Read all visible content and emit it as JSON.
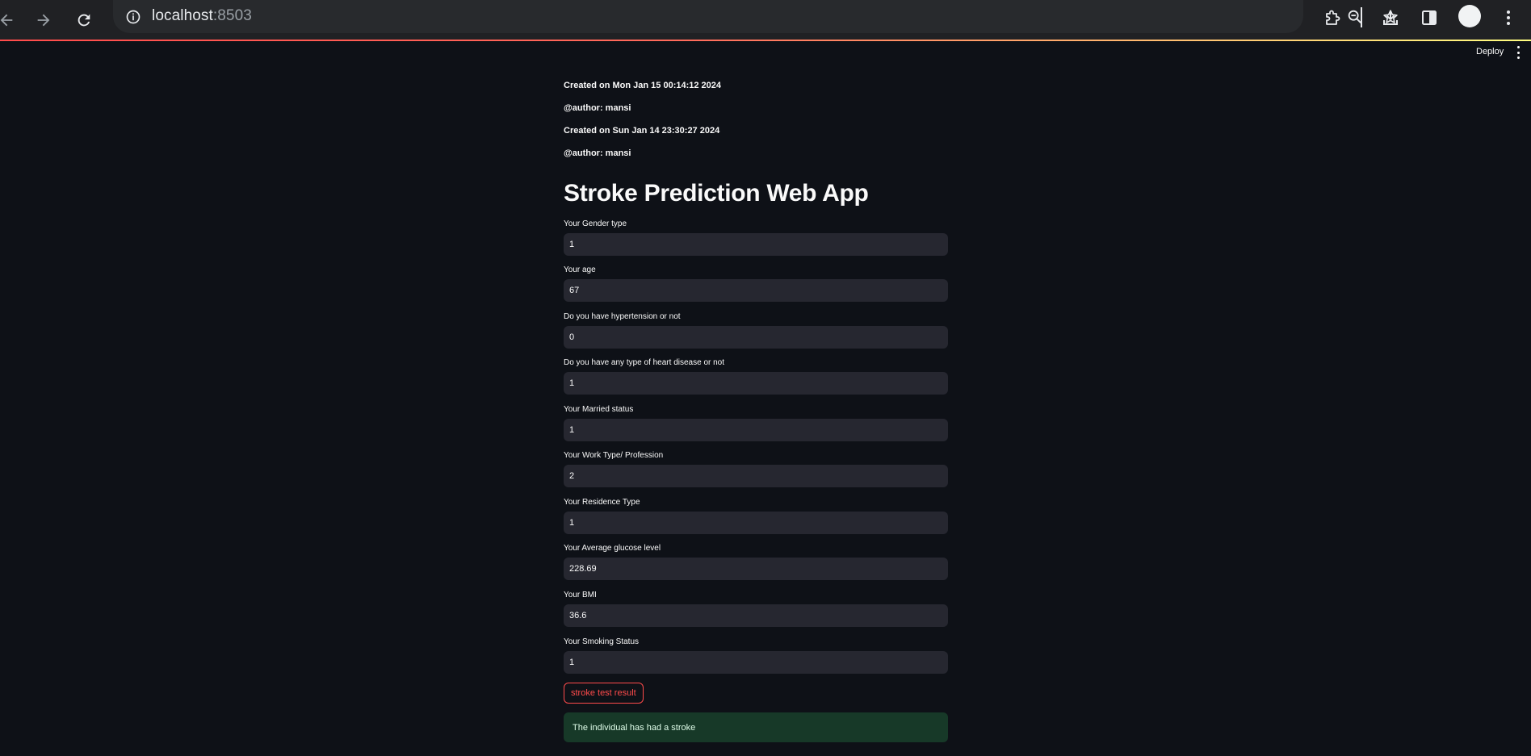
{
  "browser": {
    "url_host": "localhost",
    "url_port": ":8503",
    "icons": [
      "back-icon",
      "forward-icon",
      "reload-icon",
      "site-info-icon",
      "zoom-icon",
      "bookmark-star-icon",
      "extensions-icon",
      "download-icon",
      "side-panel-icon",
      "avatar",
      "menu-icon"
    ]
  },
  "streamlit_header": {
    "deploy_label": "Deploy"
  },
  "meta": [
    "Created on Mon Jan 15 00:14:12 2024",
    "@author: mansi",
    "Created on Sun Jan 14 23:30:27 2024",
    "@author: mansi"
  ],
  "title": "Stroke Prediction Web App",
  "fields": [
    {
      "label": "Your Gender type",
      "value": "1"
    },
    {
      "label": "Your age",
      "value": "67"
    },
    {
      "label": "Do you have hypertension or not",
      "value": "0"
    },
    {
      "label": "Do you have any type of heart disease or not",
      "value": "1"
    },
    {
      "label": "Your Married status",
      "value": "1"
    },
    {
      "label": "Your Work Type/ Profession",
      "value": "2"
    },
    {
      "label": "Your Residence Type",
      "value": "1"
    },
    {
      "label": "Your Average glucose level",
      "value": "228.69"
    },
    {
      "label": "Your BMI",
      "value": "36.6"
    },
    {
      "label": "Your Smoking Status",
      "value": "1"
    }
  ],
  "button_label": "stroke test result",
  "result_message": "The individual has had a stroke",
  "colors": {
    "background": "#0e1117",
    "input_background": "#262730",
    "primary": "#ff4b4b",
    "success_background": "#173928",
    "success_text": "#dffde9"
  }
}
